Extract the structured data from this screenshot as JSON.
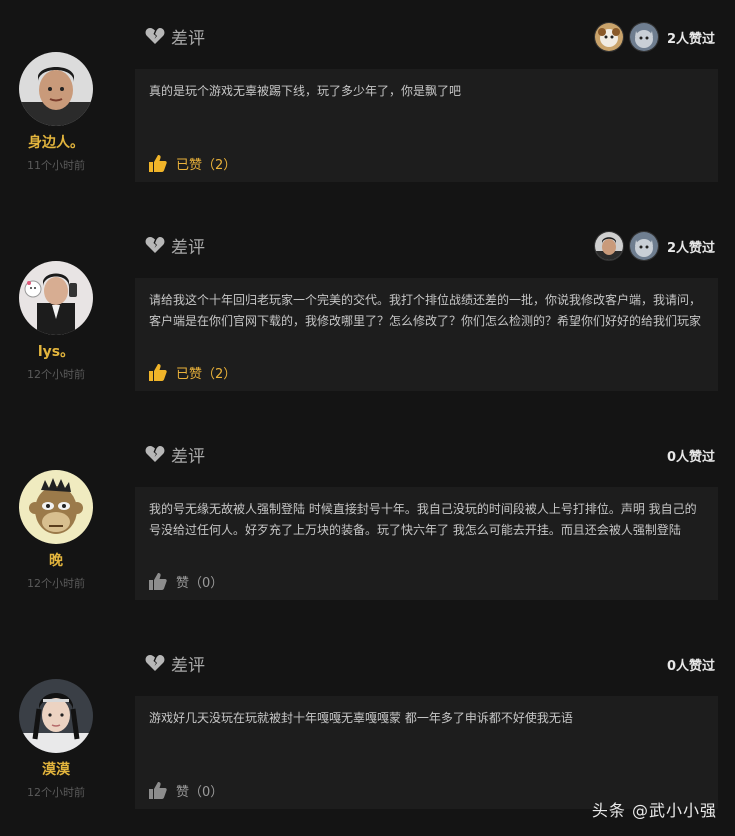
{
  "reviews": [
    {
      "verdict": "差评",
      "likers_count_label": "2人赞过",
      "user": {
        "name": "身边人。",
        "time": "11个小时前"
      },
      "text": "真的是玩个游戏无辜被踢下线，玩了多少年了，你是飘了吧",
      "like_label": "已赞（2）",
      "liked": true
    },
    {
      "verdict": "差评",
      "likers_count_label": "2人赞过",
      "user": {
        "name": "lys。",
        "time": "12个小时前"
      },
      "text": "请给我这个十年回归老玩家一个完美的交代。我打个排位战绩还差的一批，你说我修改客户端，我请问，客户端是在你们官网下载的，我修改哪里了？怎么修改了？你们怎么检测的？希望你们好好的给我们玩家一个合理地解释。无缘无故的被封禁一个小时，排位分掉了几十分。我他妈打了几天都打不了几十分。我",
      "like_label": "已赞（2）",
      "liked": true
    },
    {
      "verdict": "差评",
      "likers_count_label": "0人赞过",
      "user": {
        "name": "晚",
        "time": "12个小时前"
      },
      "text": "我的号无缘无故被人强制登陆 时候直接封号十年。我自己没玩的时间段被人上号打排位。声明 我自己的号没给过任何人。好歹充了上万块的装备。玩了快六年了 我怎么可能去开挂。而且还会被人强制登陆",
      "like_label": "赞（0）",
      "liked": false
    },
    {
      "verdict": "差评",
      "likers_count_label": "0人赞过",
      "user": {
        "name": "漠漠",
        "time": "12个小时前"
      },
      "text": "游戏好几天没玩在玩就被封十年嘎嘎无辜嘎嘎蒙 都一年多了申诉都不好使我无语",
      "like_label": "赞（0）",
      "liked": false
    }
  ],
  "watermark": "头条 @武小小强",
  "colors": {
    "background": "#141414",
    "card": "#1d1d1d",
    "gold": "#e3b53d",
    "liked": "#eab23a"
  }
}
